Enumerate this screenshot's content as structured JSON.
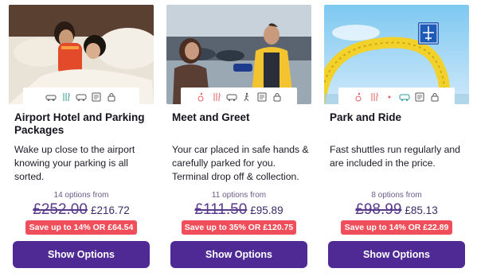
{
  "cards": [
    {
      "title": "Airport Hotel and Parking Packages",
      "description": "Wake up close to the airport knowing your parking is all sorted.",
      "options_text": "14 options from",
      "old_price": "£252.00",
      "new_price": "£216.72",
      "save_text": "Save up to 14% OR £64.54",
      "button_label": "Show Options",
      "image": "couple-sleeping-in-hotel-bed",
      "feature_icons": [
        "car-icon",
        "food-icon",
        "shuttle-icon",
        "document-icon",
        "lock-icon"
      ]
    },
    {
      "title": "Meet and Greet",
      "description": "Your car placed in safe hands & carefully parked for you. Terminal drop off & collection.",
      "options_text": "11 options from",
      "old_price": "£111.50",
      "new_price": "£95.89",
      "save_text": "Save up to 35% OR £120.75",
      "button_label": "Show Options",
      "image": "valet-handing-car-keys",
      "feature_icons": [
        "disabled-icon",
        "food-icon",
        "shuttle-icon",
        "walking-icon",
        "document-icon",
        "lock-icon"
      ]
    },
    {
      "title": "Park and Ride",
      "description": "Fast shuttles run regularly and are included in the price.",
      "options_text": "8 options from",
      "old_price": "£98.99",
      "new_price": "£85.13",
      "save_text": "Save up to 14% OR £22.89",
      "button_label": "Show Options",
      "image": "yellow-arch-airport-sign",
      "feature_icons": [
        "disabled-icon",
        "food-icon",
        "dot-icon",
        "shuttle-icon",
        "document-icon",
        "lock-icon"
      ]
    }
  ],
  "colors": {
    "accent": "#4f2a94",
    "save_badge": "#f04e5a",
    "old_price": "#5a3a8c"
  }
}
